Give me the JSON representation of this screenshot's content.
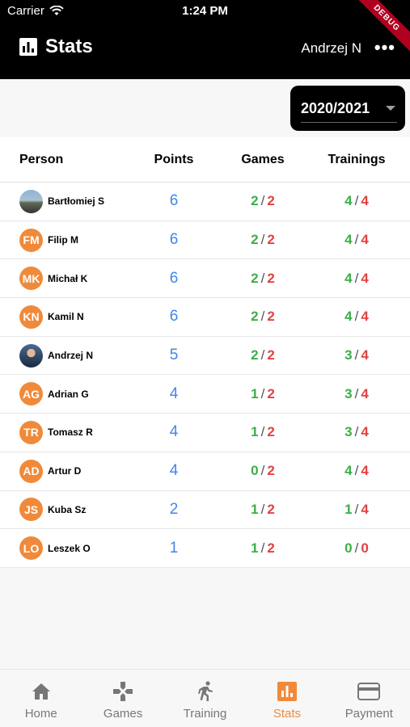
{
  "status_bar": {
    "carrier": "Carrier",
    "time": "1:24 PM",
    "debug_label": "DEBUG"
  },
  "app_bar": {
    "title": "Stats",
    "user": "Andrzej N",
    "more": "•••"
  },
  "season": {
    "value": "2020/2021"
  },
  "table": {
    "headers": {
      "person": "Person",
      "points": "Points",
      "games": "Games",
      "trainings": "Trainings"
    },
    "rows": [
      {
        "initials": "",
        "name": "Bartłomiej S",
        "points": "6",
        "games_att": "2",
        "games_total": "2",
        "train_att": "4",
        "train_total": "4"
      },
      {
        "initials": "FM",
        "name": "Filip M",
        "points": "6",
        "games_att": "2",
        "games_total": "2",
        "train_att": "4",
        "train_total": "4"
      },
      {
        "initials": "MK",
        "name": "Michał K",
        "points": "6",
        "games_att": "2",
        "games_total": "2",
        "train_att": "4",
        "train_total": "4"
      },
      {
        "initials": "KN",
        "name": "Kamil N",
        "points": "6",
        "games_att": "2",
        "games_total": "2",
        "train_att": "4",
        "train_total": "4"
      },
      {
        "initials": "",
        "name": "Andrzej N",
        "points": "5",
        "games_att": "2",
        "games_total": "2",
        "train_att": "3",
        "train_total": "4"
      },
      {
        "initials": "AG",
        "name": "Adrian G",
        "points": "4",
        "games_att": "1",
        "games_total": "2",
        "train_att": "3",
        "train_total": "4"
      },
      {
        "initials": "TR",
        "name": "Tomasz R",
        "points": "4",
        "games_att": "1",
        "games_total": "2",
        "train_att": "3",
        "train_total": "4"
      },
      {
        "initials": "AD",
        "name": "Artur D",
        "points": "4",
        "games_att": "0",
        "games_total": "2",
        "train_att": "4",
        "train_total": "4"
      },
      {
        "initials": "JS",
        "name": "Kuba Sz",
        "points": "2",
        "games_att": "1",
        "games_total": "2",
        "train_att": "1",
        "train_total": "4"
      },
      {
        "initials": "LO",
        "name": "Leszek O",
        "points": "1",
        "games_att": "1",
        "games_total": "2",
        "train_att": "0",
        "train_total": "0"
      }
    ]
  },
  "bottom_nav": {
    "items": [
      {
        "label": "Home",
        "icon": "home-icon"
      },
      {
        "label": "Games",
        "icon": "gamepad-icon"
      },
      {
        "label": "Training",
        "icon": "runner-icon"
      },
      {
        "label": "Stats",
        "icon": "bar-chart-icon"
      },
      {
        "label": "Payment",
        "icon": "credit-card-icon"
      }
    ],
    "active_index": 3
  },
  "colors": {
    "accent": "#f08a3a",
    "points": "#3f86e8",
    "attended": "#3cae48",
    "total": "#e44141"
  }
}
